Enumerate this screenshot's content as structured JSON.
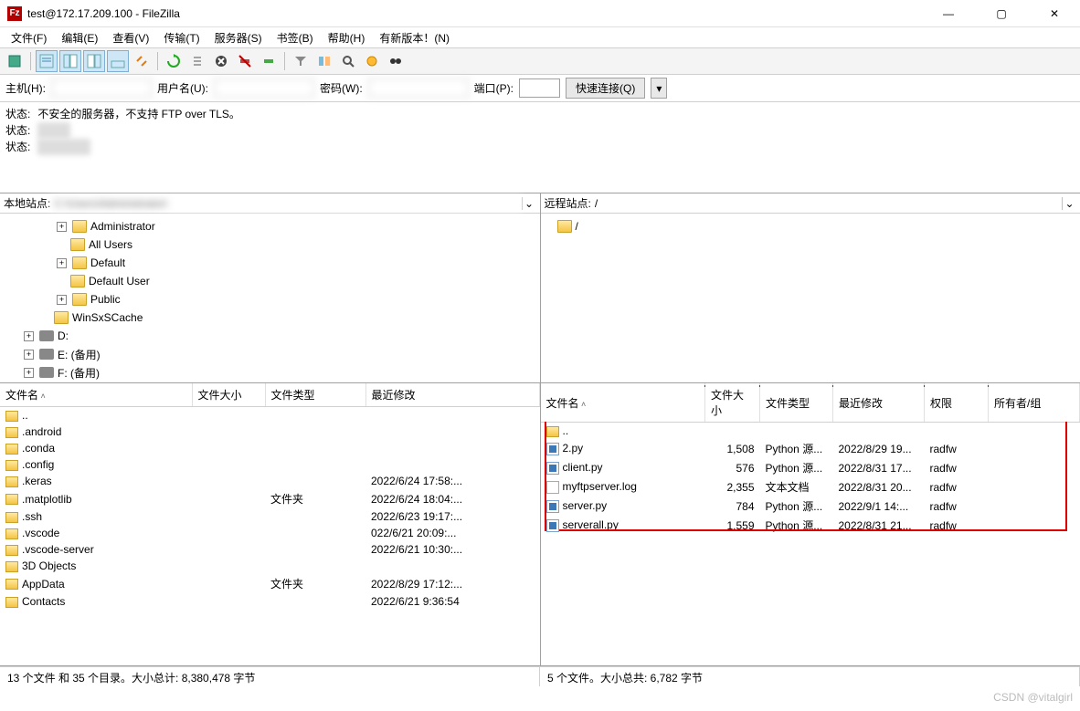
{
  "window": {
    "title": "test@172.17.209.100 - FileZilla"
  },
  "menu": {
    "file": "文件(F)",
    "edit": "编辑(E)",
    "view": "查看(V)",
    "transfer": "传输(T)",
    "server": "服务器(S)",
    "bookmark": "书签(B)",
    "help": "帮助(H)",
    "newver": "有新版本！(N)"
  },
  "quickbar": {
    "host_label": "主机(H):",
    "host_value": "",
    "user_label": "用户名(U):",
    "user_value": "",
    "pass_label": "密码(W):",
    "pass_value": "",
    "port_label": "端口(P):",
    "port_value": "",
    "connect_btn": "快速连接(Q)"
  },
  "log": {
    "label": "状态:",
    "line1": "不安全的服务器，不支持 FTP over TLS。",
    "line2": "已连接",
    "line3": "读取目录..."
  },
  "local": {
    "path_label": "本地站点:",
    "path_value": "C:\\Users\\Administrator\\",
    "tree": [
      {
        "indent": 3,
        "exp": "+",
        "icon": "folder",
        "label": "Administrator"
      },
      {
        "indent": 3,
        "exp": "",
        "icon": "folder",
        "label": "All Users"
      },
      {
        "indent": 3,
        "exp": "+",
        "icon": "folder",
        "label": "Default"
      },
      {
        "indent": 3,
        "exp": "",
        "icon": "folder",
        "label": "Default User"
      },
      {
        "indent": 3,
        "exp": "+",
        "icon": "folder",
        "label": "Public"
      },
      {
        "indent": 2,
        "exp": "",
        "icon": "folder",
        "label": "WinSxSCache"
      },
      {
        "indent": 1,
        "exp": "+",
        "icon": "disk",
        "label": "D:"
      },
      {
        "indent": 1,
        "exp": "+",
        "icon": "disk",
        "label": "E: (备用)"
      },
      {
        "indent": 1,
        "exp": "+",
        "icon": "disk",
        "label": "F: (备用)"
      }
    ],
    "cols": {
      "name": "文件名",
      "size": "文件大小",
      "type": "文件类型",
      "mod": "最近修改"
    },
    "files": [
      {
        "name": "..",
        "type": "",
        "size": "",
        "mod": "",
        "icon": "up"
      },
      {
        "name": ".android",
        "type": "",
        "size": "",
        "mod": "",
        "icon": "folder"
      },
      {
        "name": ".conda",
        "type": "",
        "size": "",
        "mod": "",
        "icon": "folder"
      },
      {
        "name": ".config",
        "type": "",
        "size": "",
        "mod": "",
        "icon": "folder"
      },
      {
        "name": ".keras",
        "type": "",
        "size": "",
        "mod": "2022/6/24 17:58:...",
        "icon": "folder"
      },
      {
        "name": ".matplotlib",
        "type": "文件夹",
        "size": "",
        "mod": "2022/6/24 18:04:...",
        "icon": "folder"
      },
      {
        "name": ".ssh",
        "type": "",
        "size": "",
        "mod": "2022/6/23 19:17:...",
        "icon": "folder"
      },
      {
        "name": ".vscode",
        "type": "",
        "size": "",
        "mod": "022/6/21 20:09:...",
        "icon": "folder"
      },
      {
        "name": ".vscode-server",
        "type": "",
        "size": "",
        "mod": "2022/6/21 10:30:...",
        "icon": "folder"
      },
      {
        "name": "3D Objects",
        "type": "",
        "size": "",
        "mod": "",
        "icon": "folder3d"
      },
      {
        "name": "AppData",
        "type": "文件夹",
        "size": "",
        "mod": "2022/8/29 17:12:...",
        "icon": "folder"
      },
      {
        "name": "Contacts",
        "type": "",
        "size": "",
        "mod": "2022/6/21 9:36:54",
        "icon": "contacts"
      }
    ],
    "status": "13 个文件 和 35 个目录。大小总计: 8,380,478 字节"
  },
  "remote": {
    "path_label": "远程站点:",
    "path_value": "/",
    "tree": [
      {
        "indent": 0,
        "exp": "",
        "icon": "folder",
        "label": "/"
      }
    ],
    "cols": {
      "name": "文件名",
      "size": "文件大小",
      "type": "文件类型",
      "mod": "最近修改",
      "perm": "权限",
      "owner": "所有者/组"
    },
    "files": [
      {
        "name": "..",
        "size": "",
        "type": "",
        "mod": "",
        "perm": "",
        "icon": "up"
      },
      {
        "name": "2.py",
        "size": "1,508",
        "type": "Python 源...",
        "mod": "2022/8/29 19...",
        "perm": "radfw",
        "icon": "py"
      },
      {
        "name": "client.py",
        "size": "576",
        "type": "Python 源...",
        "mod": "2022/8/31 17...",
        "perm": "radfw",
        "icon": "py"
      },
      {
        "name": "myftpserver.log",
        "size": "2,355",
        "type": "文本文档",
        "mod": "2022/8/31 20...",
        "perm": "radfw",
        "icon": "txt"
      },
      {
        "name": "server.py",
        "size": "784",
        "type": "Python 源...",
        "mod": "2022/9/1 14:...",
        "perm": "radfw",
        "icon": "py"
      },
      {
        "name": "serverall.py",
        "size": "1,559",
        "type": "Python 源...",
        "mod": "2022/8/31 21...",
        "perm": "radfw",
        "icon": "py"
      }
    ],
    "status": "5 个文件。大小总共: 6,782 字节"
  },
  "watermark": "CSDN @vitalgirl"
}
